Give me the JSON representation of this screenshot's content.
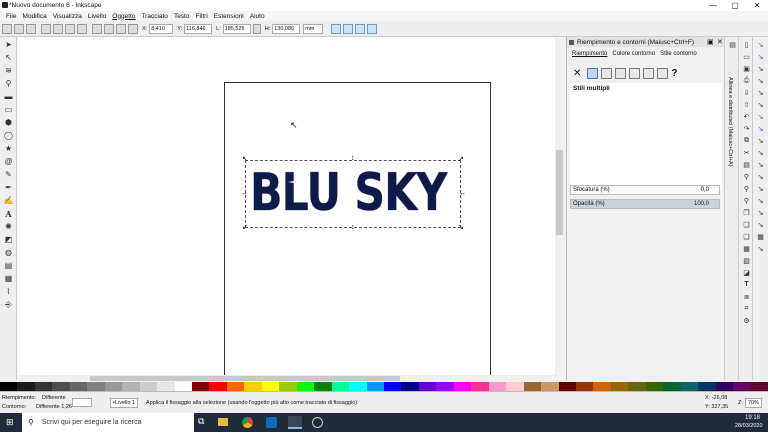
{
  "window": {
    "title": "*Nuovo documento 6 - Inkscape",
    "minimize": "—",
    "maximize": "▢",
    "close": "✕"
  },
  "menu": [
    "File",
    "Modifica",
    "Visualizza",
    "Livello",
    "Oggetto",
    "Tracciato",
    "Testo",
    "Filtri",
    "Estensioni",
    "Aiuto"
  ],
  "toolbar": {
    "x_label": "X:",
    "x_value": "8,410",
    "y_label": "Y:",
    "y_value": "116,846",
    "w_label": "L:",
    "w_value": "185,525",
    "h_label": "H:",
    "h_value": "130,086",
    "unit": "mm"
  },
  "canvas": {
    "text": "BLU SKY"
  },
  "panel": {
    "title": "Riempimento e contorni (Maiusc+Ctrl+F)",
    "tabs": [
      "Riempimento",
      "Colore contorno",
      "Stile contorno"
    ],
    "multi_label": "Stili multipli",
    "blur_label": "Sfocatura (%)",
    "blur_value": "0,0",
    "opacity_label": "Opacità (%)",
    "opacity_value": "100,0"
  },
  "dock": {
    "vertical_label": "Allinea e distribuisci (Maiusc+Ctrl+A)"
  },
  "status": {
    "fill_label": "Riempimento:",
    "fill_value": "Differente",
    "stroke_label": "Contorno:",
    "stroke_value": "Differente 1,26",
    "layer": "•Livello 1",
    "message": "Applica il fissaggio alla selezione (usando l'oggetto più alto come tracciato di fissaggio)",
    "x_coord": "X: -26,08",
    "y_coord": "Y: 327,35",
    "zoom_label": "Z:",
    "zoom_value": "70%"
  },
  "taskbar": {
    "search_placeholder": "Scrivi qui per eseguire la ricerca",
    "time": "19:18",
    "date": "28/03/2020"
  },
  "palette": [
    "#000000",
    "#1a1a1a",
    "#333333",
    "#4d4d4d",
    "#666666",
    "#808080",
    "#999999",
    "#b3b3b3",
    "#cccccc",
    "#e6e6e6",
    "#ffffff",
    "#800000",
    "#ff0000",
    "#ff6600",
    "#ffcc00",
    "#ffff00",
    "#99cc00",
    "#00ff00",
    "#008000",
    "#00ff99",
    "#00ffff",
    "#0099ff",
    "#0000ff",
    "#000080",
    "#6600cc",
    "#9900ff",
    "#ff00ff",
    "#ff3399",
    "#ff99cc",
    "#ffcccc",
    "#996633",
    "#cc9966",
    "#660000",
    "#993300",
    "#cc6600",
    "#996600",
    "#666600",
    "#336600",
    "#006633",
    "#006666",
    "#003366",
    "#330066",
    "#660066",
    "#660033"
  ]
}
